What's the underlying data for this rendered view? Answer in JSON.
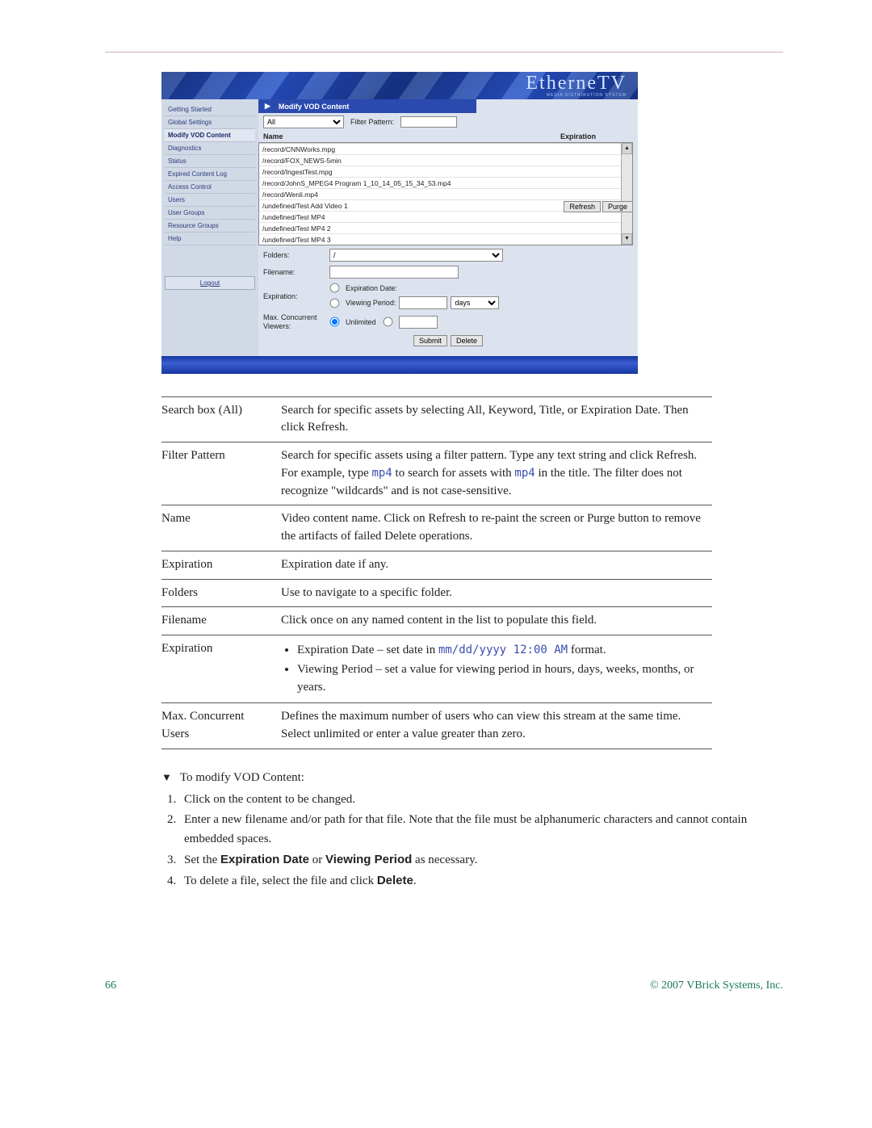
{
  "brand": {
    "name": "EtherneTV",
    "sub": "MEDIA DISTRIBUTION SYSTEM"
  },
  "breadcrumb": {
    "title": "Modify VOD Content"
  },
  "sidebar": {
    "items": [
      "Getting Started",
      "Global Settings",
      "Modify VOD Content",
      "Diagnostics",
      "Status",
      "Expired Content Log",
      "Access Control",
      "Users",
      "User Groups",
      "Resource Groups",
      "Help"
    ],
    "activeIndex": 2,
    "logout": "Logout"
  },
  "filter": {
    "search_option": "All",
    "pattern_label": "Filter Pattern:",
    "pattern_value": ""
  },
  "list": {
    "head_name": "Name",
    "head_exp": "Expiration",
    "rows": [
      "/record/CNNWorks.mpg",
      "/record/FOX_NEWS-5min",
      "/record/IngestTest.mpg",
      "/record/JohnS_MPEG4 Program 1_10_14_05_15_34_53.mp4",
      "/record/Wenli.mp4",
      "/undefined/Test Add Video 1",
      "/undefined/Test MP4",
      "/undefined/Test MP4 2",
      "/undefined/Test MP4 3"
    ]
  },
  "buttons": {
    "refresh": "Refresh",
    "purge": "Purge",
    "submit": "Submit",
    "delete": "Delete"
  },
  "form": {
    "folders_label": "Folders:",
    "folders_value": "/",
    "filename_label": "Filename:",
    "filename_value": "",
    "expiration_label": "Expiration:",
    "opt_expdate": "Expiration Date:",
    "opt_viewperiod": "Viewing Period:",
    "vp_number": "",
    "vp_unit": "days",
    "mcv_label": "Max. Concurrent Viewers:",
    "mcv_unlimited": "Unlimited",
    "mcv_value": ""
  },
  "desc": {
    "rows": [
      {
        "k": "Search box (All)",
        "v": "Search for specific assets by selecting All, Keyword, Title, or Expiration Date. Then click Refresh."
      },
      {
        "k": "Filter Pattern",
        "v_parts": [
          "Search for specific assets using a filter pattern. Type any text string and click Refresh. For example, type ",
          {
            "code": "mp4"
          },
          " to search for assets with ",
          {
            "code": "mp4"
          },
          " in the title. The filter does not recognize \"wildcards\" and is not case-sensitive."
        ]
      },
      {
        "k": "Name",
        "v": "Video content name. Click on Refresh to re-paint the screen or Purge button to remove the artifacts of failed Delete operations."
      },
      {
        "k": "Expiration",
        "v": "Expiration date if any."
      },
      {
        "k": "Folders",
        "v": "Use to navigate to a specific folder."
      },
      {
        "k": "Filename",
        "v": "Click once on any named content in the list to populate this field."
      },
      {
        "k": "Expiration",
        "bullets": [
          {
            "parts": [
              "Expiration Date – set date in ",
              {
                "code": "mm/dd/yyyy 12:00 AM"
              },
              " format."
            ]
          },
          {
            "text": "Viewing Period – set a value for viewing period in hours, days, weeks, months, or years."
          }
        ]
      },
      {
        "k": "Max. Concurrent Users",
        "v": "Defines the maximum number of users who can view this stream at the same time. Select unlimited or enter a value greater than zero."
      }
    ]
  },
  "procedure": {
    "head": "To modify VOD Content:",
    "steps_html": [
      "Click on the content to be changed.",
      "Enter a new filename and/or path for that file. Note that the file must be alphanumeric characters and cannot contain embedded spaces.",
      "Set the <b>Expiration Date</b> or <b>Viewing Period</b> as necessary.",
      "To delete a file, select the file and click <b>Delete</b>."
    ]
  },
  "footer": {
    "page": "66",
    "copyright": "© 2007 VBrick Systems, Inc."
  }
}
